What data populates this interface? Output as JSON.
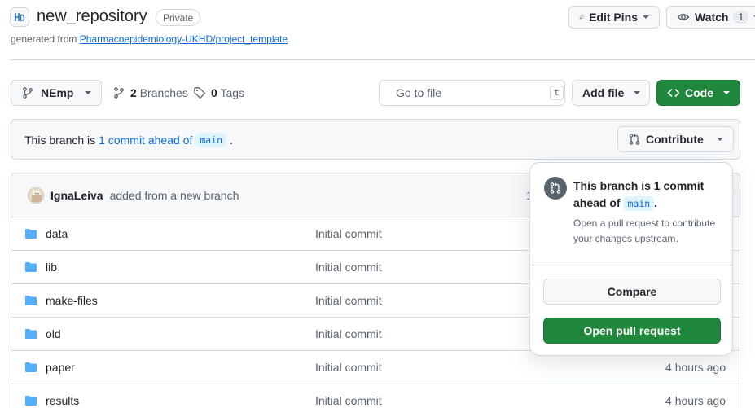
{
  "header": {
    "repo_name": "new_repository",
    "visibility_badge": "Private",
    "generated_prefix": "generated from",
    "template_link": "Pharmacoepidemiology-UKHD/project_template",
    "edit_pins_label": "Edit Pins",
    "watch_label": "Watch",
    "watch_count": "1"
  },
  "toolbar": {
    "branch_name": "NEmp",
    "branches_count": "2",
    "branches_label": "Branches",
    "tags_count": "0",
    "tags_label": "Tags",
    "search_placeholder": "Go to file",
    "search_shortcut": "t",
    "add_file_label": "Add file",
    "code_label": "Code"
  },
  "banner": {
    "prefix": "This branch is",
    "link_text": "1 commit ahead of",
    "base_branch": "main",
    "suffix": ".",
    "contribute_label": "Contribute"
  },
  "latest_commit": {
    "author": "IgnaLeiva",
    "message": "added from a new branch",
    "partial_hash": "1"
  },
  "files": [
    {
      "name": "data",
      "message": "Initial commit",
      "time": ""
    },
    {
      "name": "lib",
      "message": "Initial commit",
      "time": ""
    },
    {
      "name": "make-files",
      "message": "Initial commit",
      "time": ""
    },
    {
      "name": "old",
      "message": "Initial commit",
      "time": ""
    },
    {
      "name": "paper",
      "message": "Initial commit",
      "time": "4 hours ago"
    },
    {
      "name": "results",
      "message": "Initial commit",
      "time": "4 hours ago"
    }
  ],
  "popover": {
    "title_prefix": "This branch is 1 commit ahead of",
    "title_branch": "main",
    "title_suffix": ".",
    "description": "Open a pull request to contribute your changes upstream.",
    "compare_label": "Compare",
    "open_pr_label": "Open pull request"
  },
  "colors": {
    "accent_green": "#1f883d",
    "link_blue": "#0969da",
    "folder_blue": "#54aeff",
    "border": "#d1d9e0",
    "muted_text": "#59636e"
  }
}
